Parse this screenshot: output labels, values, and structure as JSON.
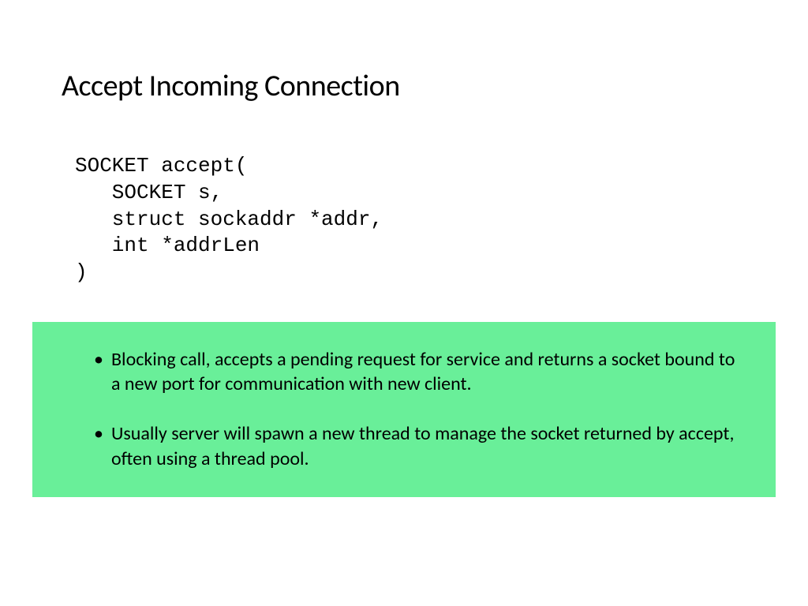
{
  "title": "Accept Incoming Connection",
  "code": {
    "line1": "SOCKET accept(",
    "line2": "   SOCKET s,",
    "line3": "   struct sockaddr *addr,",
    "line4": "   int *addrLen",
    "line5": ")"
  },
  "bullets": {
    "item1": "Blocking call, accepts a pending request for service and returns a socket bound to a new port for communication with new client.",
    "item2": "Usually server will spawn a new thread to manage the socket returned by accept, often using a thread pool."
  },
  "colors": {
    "box_bg": "#69ef99"
  }
}
